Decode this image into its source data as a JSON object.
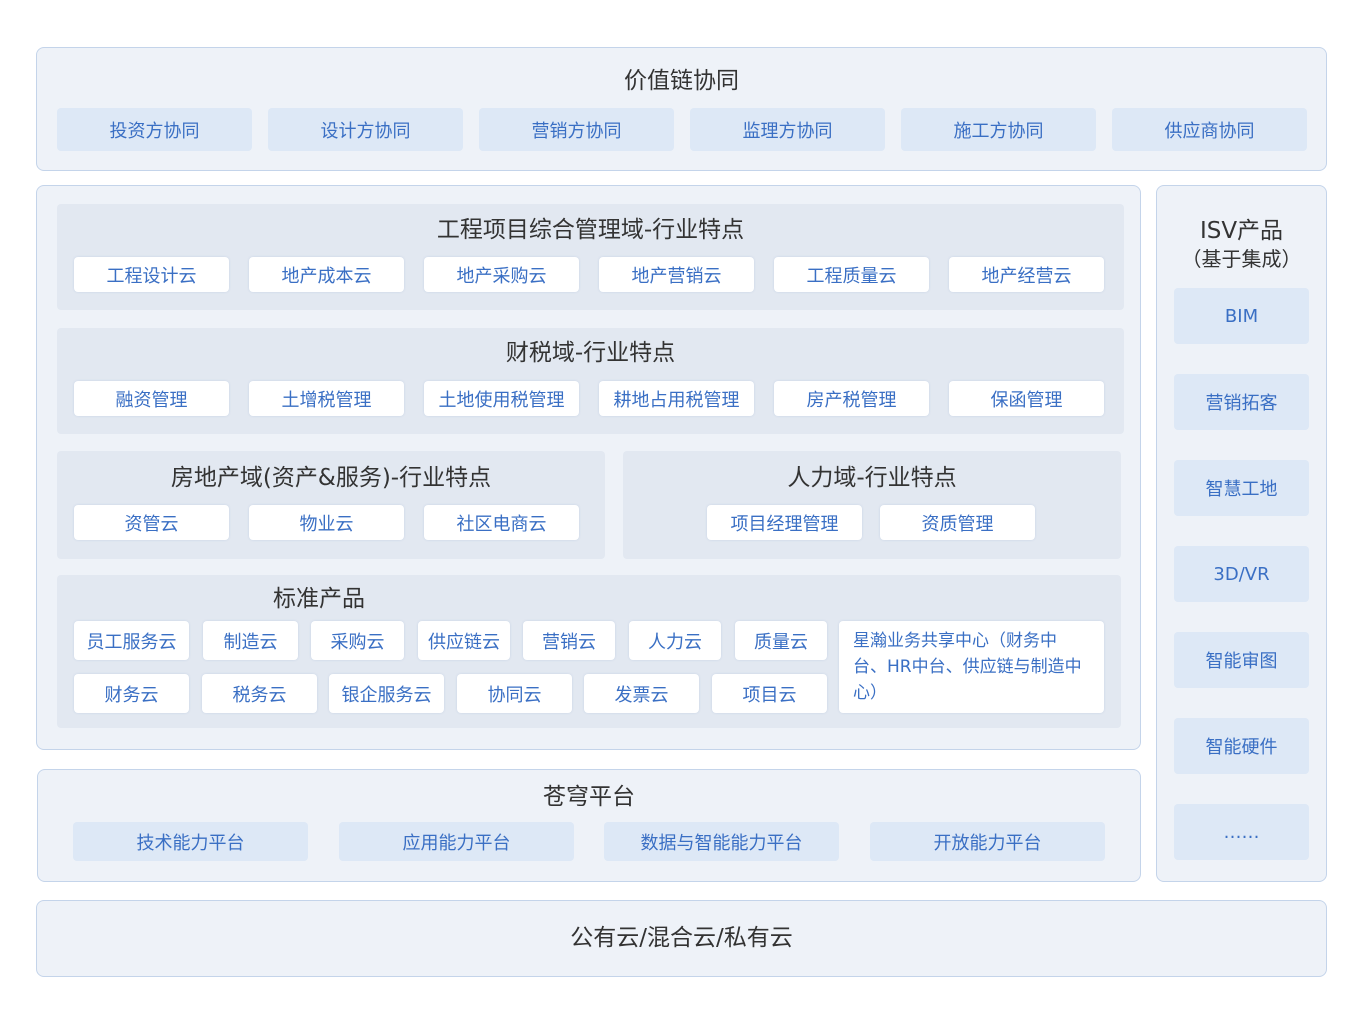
{
  "value_chain": {
    "title": "价值链协同",
    "items": [
      "投资方协同",
      "设计方协同",
      "营销方协同",
      "监理方协同",
      "施工方协同",
      "供应商协同"
    ]
  },
  "engineering": {
    "title": "工程项目综合管理域-行业特点",
    "items": [
      "工程设计云",
      "地产成本云",
      "地产采购云",
      "地产营销云",
      "工程质量云",
      "地产经营云"
    ]
  },
  "finance_tax": {
    "title": "财税域-行业特点",
    "items": [
      "融资管理",
      "土增税管理",
      "土地使用税管理",
      "耕地占用税管理",
      "房产税管理",
      "保函管理"
    ]
  },
  "real_estate": {
    "title": "房地产域(资产&服务)-行业特点",
    "items": [
      "资管云",
      "物业云",
      "社区电商云"
    ]
  },
  "hr": {
    "title": "人力域-行业特点",
    "items": [
      "项目经理管理",
      "资质管理"
    ]
  },
  "standard": {
    "title": "标准产品",
    "row1": [
      "员工服务云",
      "制造云",
      "采购云",
      "供应链云",
      "营销云",
      "人力云",
      "质量云"
    ],
    "row2": [
      "财务云",
      "税务云",
      "银企服务云",
      "协同云",
      "发票云",
      "项目云"
    ],
    "shared_center": "星瀚业务共享中心（财务中台、HR中台、供应链与制造中心）"
  },
  "platform": {
    "title": "苍穹平台",
    "items": [
      "技术能力平台",
      "应用能力平台",
      "数据与智能能力平台",
      "开放能力平台"
    ]
  },
  "cloud": {
    "title": "公有云/混合云/私有云"
  },
  "isv": {
    "title": "ISV产品",
    "subtitle": "（基于集成）",
    "items": [
      "BIM",
      "营销拓客",
      "智慧工地",
      "3D/VR",
      "智能审图",
      "智能硬件",
      "……"
    ]
  },
  "colors": {
    "panel_bg": "#eef2f8",
    "panel_border": "#c4d4ea",
    "inner_bg": "#e2e8f1",
    "chip_light": "#dde8f6",
    "chip_text": "#3a6fc4",
    "title_text": "#333333"
  }
}
